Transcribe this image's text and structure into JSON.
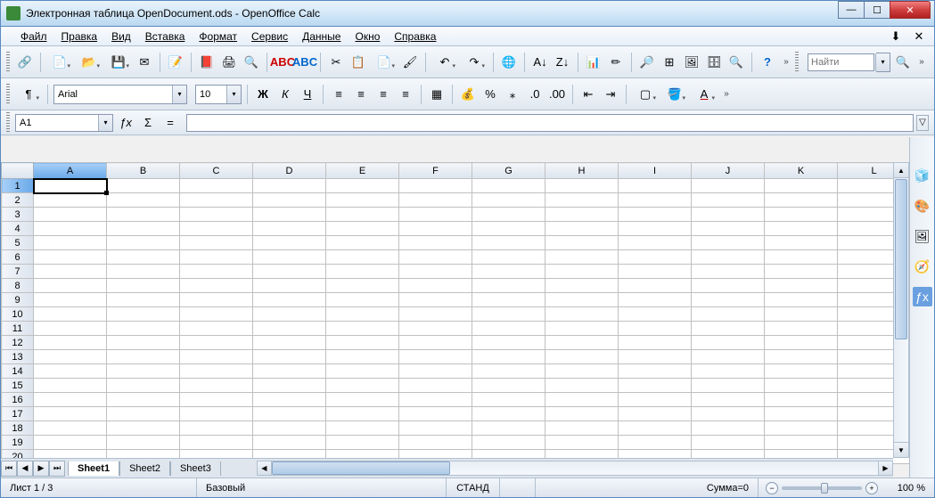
{
  "window": {
    "title": "Электронная таблица OpenDocument.ods - OpenOffice Calc"
  },
  "menu": {
    "file": "Файл",
    "edit": "Правка",
    "view": "Вид",
    "insert": "Вставка",
    "format": "Формат",
    "tools": "Сервис",
    "data": "Данные",
    "window": "Окно",
    "help": "Справка"
  },
  "find": {
    "placeholder": "Найти"
  },
  "format_bar": {
    "font": "Arial",
    "size": "10"
  },
  "cellref": "A1",
  "columns": [
    "A",
    "B",
    "C",
    "D",
    "E",
    "F",
    "G",
    "H",
    "I",
    "J",
    "K",
    "L"
  ],
  "rows": [
    1,
    2,
    3,
    4,
    5,
    6,
    7,
    8,
    9,
    10,
    11,
    12,
    13,
    14,
    15,
    16,
    17,
    18,
    19,
    20
  ],
  "active_col": "A",
  "active_row": 1,
  "sheets": {
    "tabs": [
      "Sheet1",
      "Sheet2",
      "Sheet3"
    ],
    "active": "Sheet1"
  },
  "status": {
    "sheet_pos": "Лист 1 / 3",
    "style": "Базовый",
    "mode": "СТАНД",
    "sum": "Сумма=0",
    "zoom": "100 %"
  }
}
